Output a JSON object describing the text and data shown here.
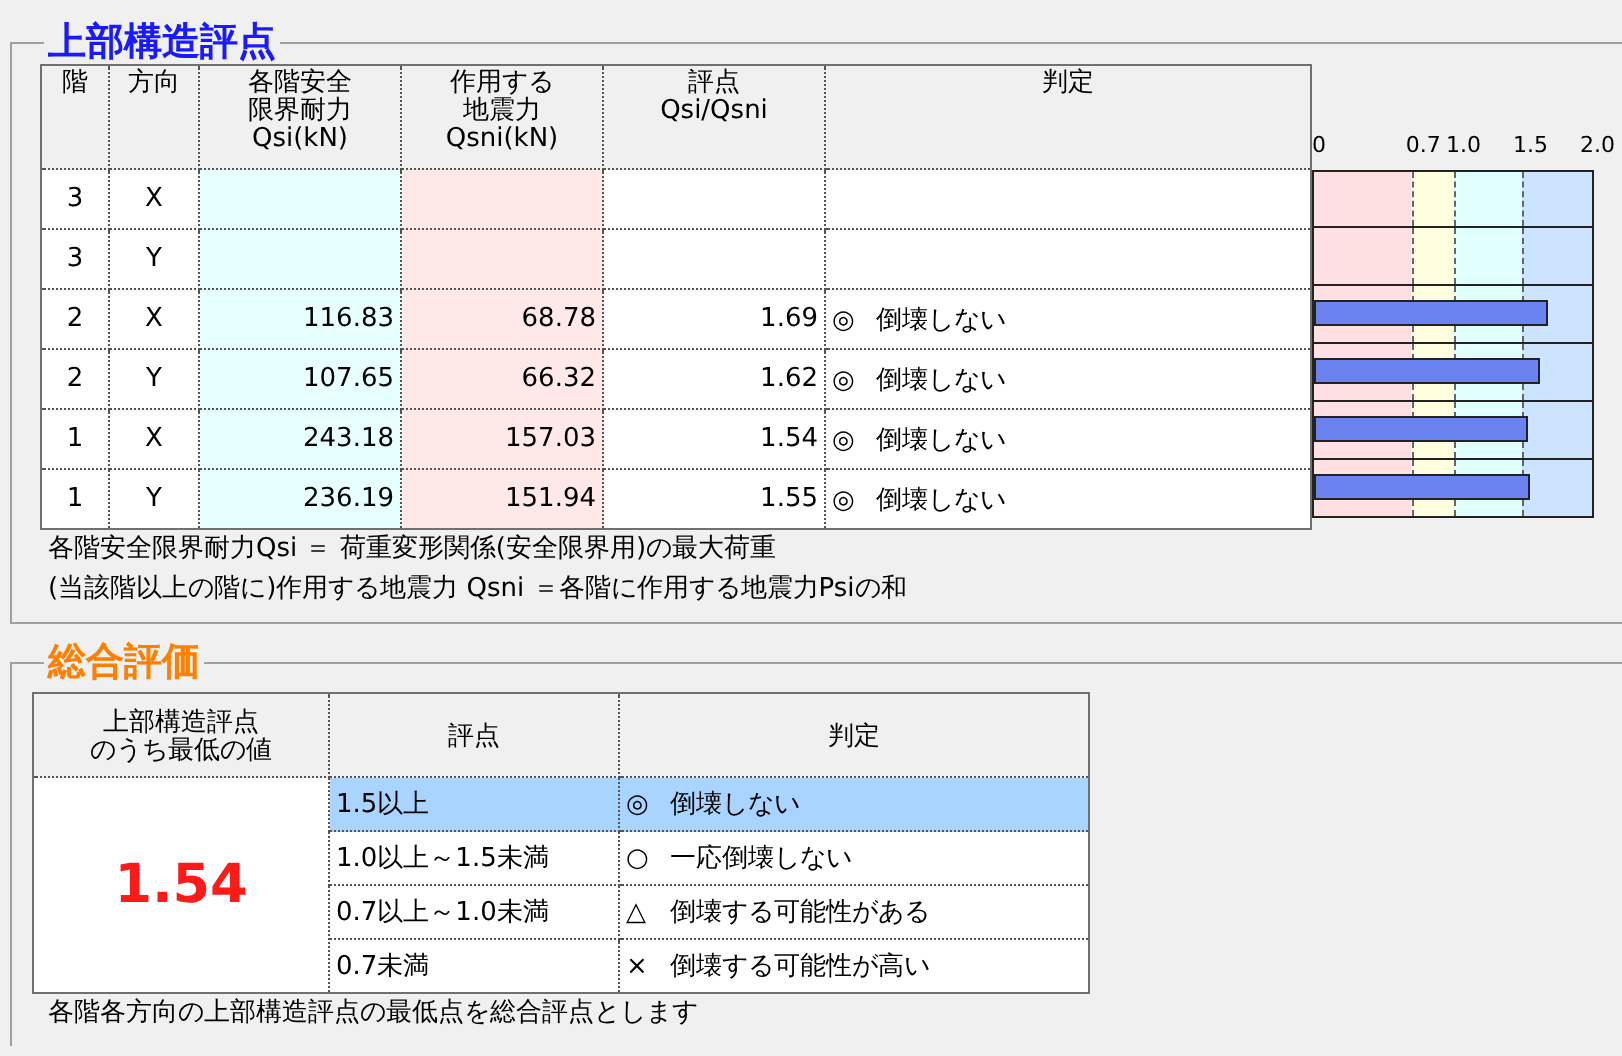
{
  "upper": {
    "title": "上部構造評点",
    "columns": [
      [
        "階"
      ],
      [
        "方向"
      ],
      [
        "各階安全",
        "限界耐力",
        "Qsi(kN)"
      ],
      [
        "作用する",
        "地震力",
        "Qsni(kN)"
      ],
      [
        "評点",
        "Qsi/Qsni"
      ],
      [
        "判定"
      ]
    ],
    "scale": [
      "0",
      "0.7",
      "1.0",
      "1.5",
      "2.0"
    ],
    "rows": [
      {
        "floor": "3",
        "direction": "X"
      },
      {
        "floor": "3",
        "direction": "Y"
      },
      {
        "floor": "2",
        "direction": "X",
        "qsi": "116.83",
        "qsni": "68.78",
        "score": "1.69",
        "symbol": "◎",
        "judgment": "倒壊しない",
        "level": 0.845
      },
      {
        "floor": "2",
        "direction": "Y",
        "qsi": "107.65",
        "qsni": "66.32",
        "score": "1.62",
        "symbol": "◎",
        "judgment": "倒壊しない",
        "level": 0.81
      },
      {
        "floor": "1",
        "direction": "X",
        "qsi": "243.18",
        "qsni": "157.03",
        "score": "1.54",
        "symbol": "◎",
        "judgment": "倒壊しない",
        "level": 0.77
      },
      {
        "floor": "1",
        "direction": "Y",
        "qsi": "236.19",
        "qsni": "151.94",
        "score": "1.55",
        "symbol": "◎",
        "judgment": "倒壊しない",
        "level": 0.775
      }
    ],
    "notes": [
      "各階安全限界耐力Qsi ＝ 荷重変形関係(安全限界用)の最大荷重",
      "(当該階以上の階に)作用する地震力 Qsni ＝各階に作用する地震力Psiの和"
    ]
  },
  "overall": {
    "title": "総合評価",
    "columns": [
      [
        "上部構造評点",
        "のうち最低の値"
      ],
      [
        "評点"
      ],
      [
        "判定"
      ]
    ],
    "value": "1.54",
    "rows": [
      {
        "range": "1.5以上",
        "symbol": "◎",
        "judgment": "倒壊しない",
        "selected": true
      },
      {
        "range": "1.0以上～1.5未満",
        "symbol": "○",
        "judgment": "一応倒壊しない",
        "selected": false
      },
      {
        "range": "0.7以上～1.0未満",
        "symbol": "△",
        "judgment": "倒壊する可能性がある",
        "selected": false
      },
      {
        "range": "0.7未満",
        "symbol": "×",
        "judgment": "倒壊する可能性が高い",
        "selected": false
      }
    ],
    "note": "各階各方向の上部構造評点の最低点を総合評点とします"
  }
}
